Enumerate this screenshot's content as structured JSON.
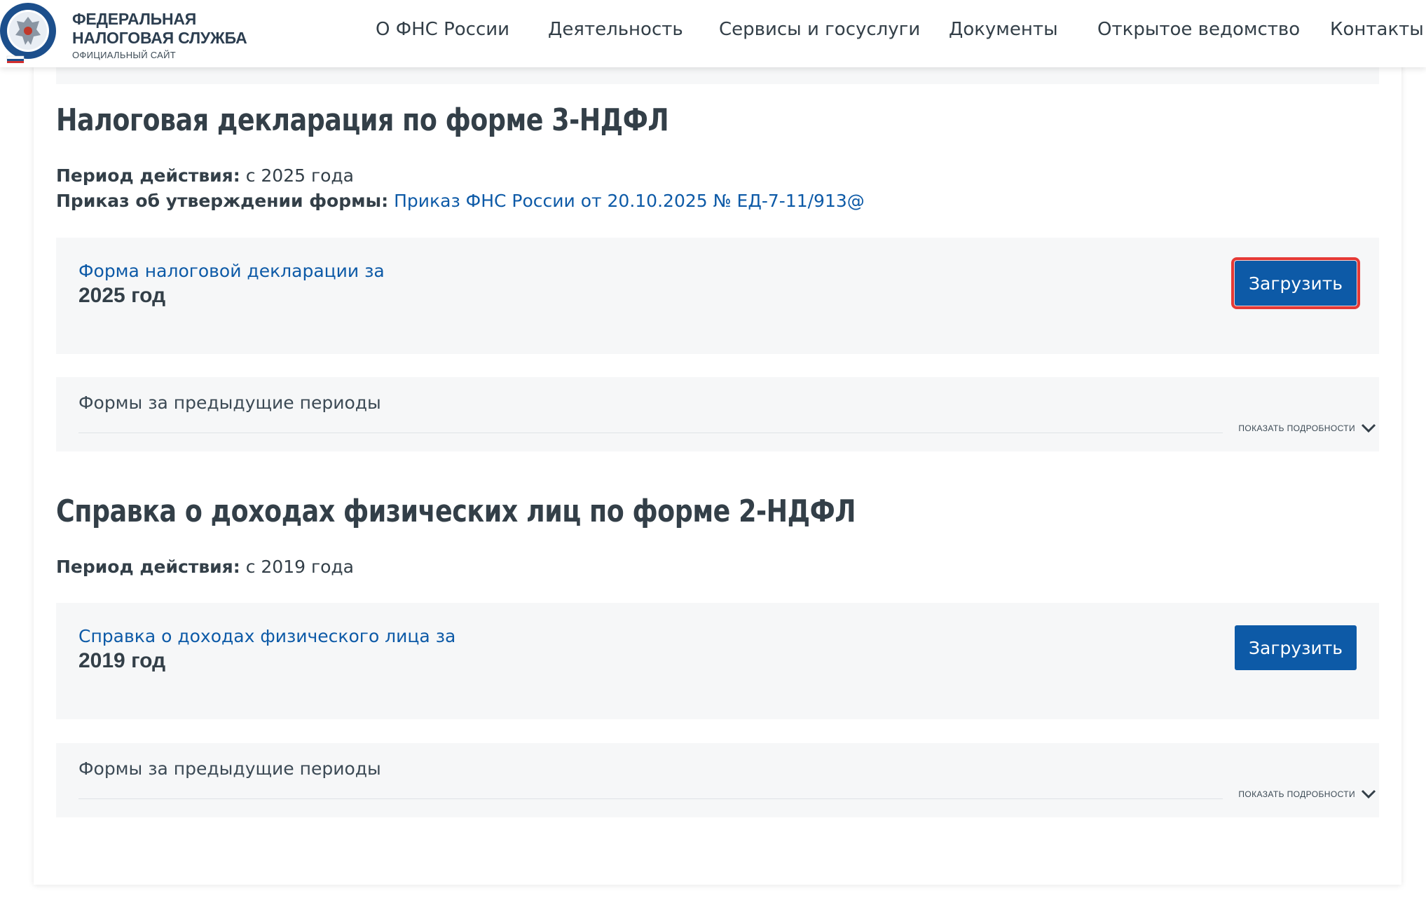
{
  "header": {
    "logo": {
      "line1": "ФЕДЕРАЛЬНАЯ",
      "line2": "НАЛОГОВАЯ СЛУЖБА",
      "subtitle": "ОФИЦИАЛЬНЫЙ САЙТ",
      "emblem_ring_text": "ФЕДЕРАЛЬНАЯ НАЛОГОВАЯ СЛУЖБА",
      "emblem_icon": "fns-emblem-icon"
    },
    "nav": [
      {
        "label": "О ФНС России"
      },
      {
        "label": "Деятельность"
      },
      {
        "label": "Сервисы и госуслуги"
      },
      {
        "label": "Документы"
      },
      {
        "label": "Открытое ведомство"
      },
      {
        "label": "Контакты"
      }
    ]
  },
  "sections": [
    {
      "title": "Налоговая декларация по форме 3-НДФЛ",
      "period_label": "Период действия:",
      "period_value": "с 2025 года",
      "order_label": "Приказ об утверждении формы:",
      "order_link": "Приказ ФНС России от 20.10.2025 № ЕД-7-11/913@",
      "form_link": "Форма налоговой декларации за",
      "form_year": "2025 год",
      "download_label": "Загрузить",
      "download_highlighted": true,
      "previous": {
        "title": "Формы за предыдущие периоды",
        "toggle_label": "показать подробности",
        "toggle_icon": "chevron-down-icon"
      }
    },
    {
      "title": "Справка о доходах физических лиц по форме 2-НДФЛ",
      "period_label": "Период действия:",
      "period_value": "с 2019 года",
      "form_link": "Справка о доходах физического лица за",
      "form_year": "2019 год",
      "download_label": "Загрузить",
      "download_highlighted": false,
      "previous": {
        "title": "Формы за предыдущие периоды",
        "toggle_label": "показать подробности",
        "toggle_icon": "chevron-down-icon"
      }
    }
  ],
  "colors": {
    "link": "#0d5aa7",
    "button": "#0d5aa7",
    "text": "#333f48",
    "panel": "#f6f7f8",
    "highlight": "#e53935"
  }
}
